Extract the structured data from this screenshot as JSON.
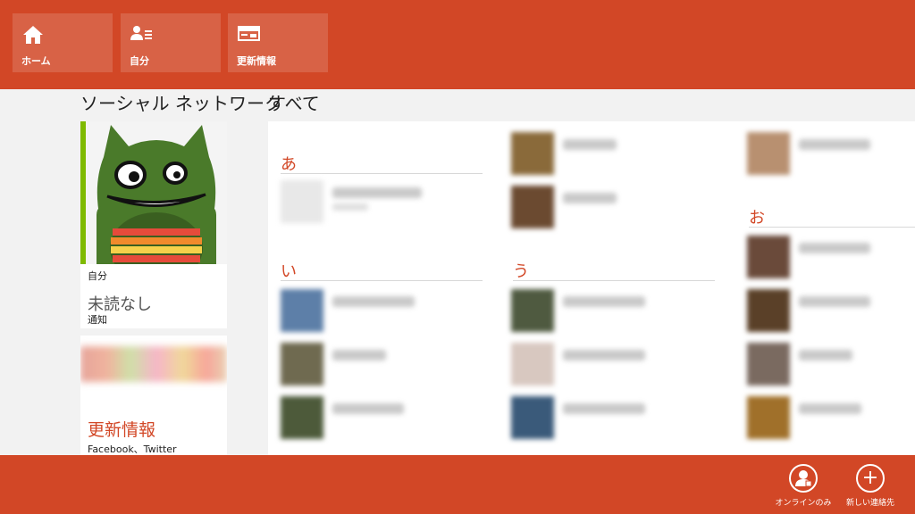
{
  "nav": [
    {
      "label": "ホーム",
      "icon": "home-icon"
    },
    {
      "label": "自分",
      "icon": "me-list-icon"
    },
    {
      "label": "更新情報",
      "icon": "whats-new-icon"
    }
  ],
  "sections": {
    "social": "ソーシャル ネットワーク",
    "all": "すべて"
  },
  "me_tile": {
    "name": "自分",
    "unread": "未読なし",
    "notifications": "通知"
  },
  "updates_tile": {
    "title": "更新情報",
    "subtitle": "Facebook、Twitter"
  },
  "groups": [
    "あ",
    "い",
    "う",
    "お"
  ],
  "app_bar": [
    {
      "label": "オンラインのみ",
      "icon": "person-online-icon"
    },
    {
      "label": "新しい連絡先",
      "icon": "plus-icon",
      "glyph": "+"
    }
  ],
  "colors": {
    "accent": "#d24726",
    "me_accent": "#7fba00",
    "background": "#f2f2f2"
  }
}
